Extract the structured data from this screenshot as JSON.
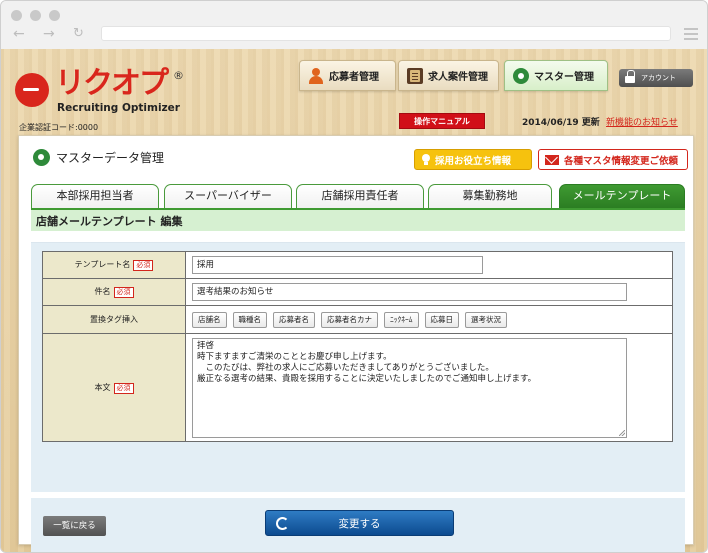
{
  "header": {
    "logo_text": "リクオプ",
    "logo_reg": "®",
    "logo_sub": "Recruiting Optimizer",
    "company_code": "企業認証コード:0000",
    "nav": [
      {
        "label": "応募者管理",
        "icon": "person-icon"
      },
      {
        "label": "求人案件管理",
        "icon": "notebook-icon"
      },
      {
        "label": "マスター管理",
        "icon": "gear-icon"
      }
    ],
    "account_label": "アカウント",
    "manual_label": "操作マニュアル",
    "update_date": "2014/06/19 更新",
    "update_link": "新機能のお知らせ"
  },
  "panel": {
    "title": "マスターデータ管理",
    "help_label": "採用お役立ち情報",
    "request_label": "各種マスタ情報変更ご依頼",
    "tabs": [
      "本部採用担当者",
      "スーパーバイザー",
      "店舗採用責任者",
      "募集勤務地",
      "メールテンプレート"
    ],
    "section_title": "店舗メールテンプレート 編集"
  },
  "form": {
    "required_label": "必須",
    "template_name_label": "テンプレート名",
    "template_name_value": "採用",
    "subject_label": "件名",
    "subject_value": "選考結果のお知らせ",
    "tag_insert_label": "置換タグ挿入",
    "tags": [
      "店舗名",
      "職種名",
      "応募者名",
      "応募者名カナ",
      "ﾆｯｸﾈｰﾑ",
      "応募日",
      "選考状況"
    ],
    "body_label": "本文",
    "body_value": "拝啓\n時下ますますご清栄のこととお慶び申し上げます。\n　このたびは、弊社の求人にご応募いただきましてありがとうございました。\n厳正なる選考の結果、貴殿を採用することに決定いたしましたのでご通知申し上げます。"
  },
  "footer": {
    "back_label": "一覧に戻る",
    "submit_label": "変更する"
  }
}
